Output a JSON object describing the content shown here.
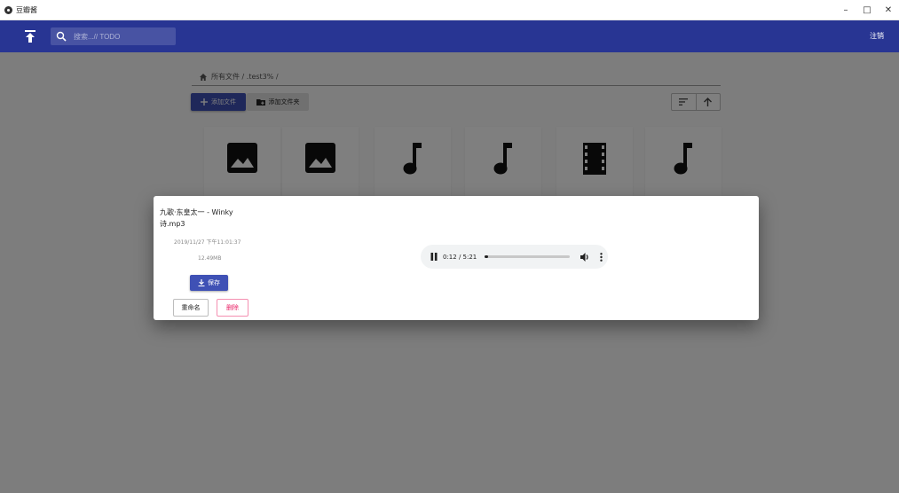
{
  "window": {
    "title": "豆瓣酱",
    "minimize": "–",
    "maximize": "□",
    "close": "✕"
  },
  "appbar": {
    "search_placeholder": "搜索...// TODO",
    "logout_label": "注销"
  },
  "breadcrumb": {
    "path": "所有文件 / .test3% /"
  },
  "toolbar": {
    "add_file_label": "添加文件",
    "add_folder_label": "添加文件夹"
  },
  "files": [
    {
      "icon": "image-icon"
    },
    {
      "icon": "image-icon"
    },
    {
      "icon": "music-note-icon"
    },
    {
      "icon": "music-note-icon"
    },
    {
      "icon": "movie-icon"
    },
    {
      "icon": "music-note-icon"
    }
  ],
  "dialog": {
    "file_name": "九歌·东皇太一 - Winky诗.mp3",
    "date": "2019/11/27 下午11:01:37",
    "size": "12.49MB",
    "save_label": "保存",
    "rename_label": "重命名",
    "delete_label": "删除",
    "player": {
      "time": "0:12 / 5:21",
      "progress_fraction": 0.04
    }
  },
  "colors": {
    "primary": "#283593",
    "accent": "#3f51b5",
    "danger": "#e91e63"
  }
}
